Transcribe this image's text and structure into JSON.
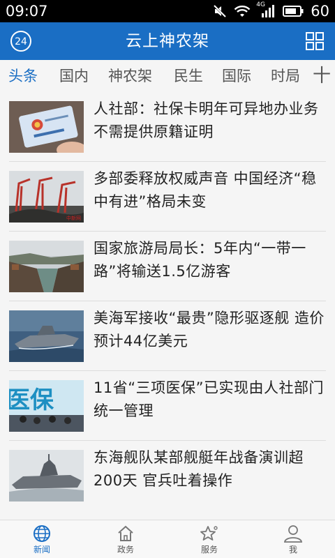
{
  "status_bar": {
    "time": "09:07",
    "network_label": "4G",
    "battery": "60",
    "icons": [
      "mute-icon",
      "wifi-icon",
      "cell-signal-icon",
      "battery-icon"
    ]
  },
  "app_bar": {
    "title": "云上神农架",
    "logo_text": "24",
    "accent_color": "#1a6ec4"
  },
  "tabs": [
    {
      "label": "头条",
      "active": true
    },
    {
      "label": "国内",
      "active": false
    },
    {
      "label": "神农架",
      "active": false
    },
    {
      "label": "民生",
      "active": false
    },
    {
      "label": "国际",
      "active": false
    },
    {
      "label": "时局",
      "active": false
    }
  ],
  "tabs_more": "十",
  "news": [
    {
      "title": "人社部：社保卡明年可异地办业务 不需提供原籍证明",
      "thumb": "social-security-card"
    },
    {
      "title": "多部委释放权威声音 中国经济“稳中有进”格局未变",
      "thumb": "port-cranes"
    },
    {
      "title": "国家旅游局局长：5年内“一带一路”将输送1.5亿游客",
      "thumb": "river-town"
    },
    {
      "title": "美海军接收“最贵”隐形驱逐舰 造价预计44亿美元",
      "thumb": "stealth-destroyer"
    },
    {
      "title": "11省“三项医保”已实现由人社部门统一管理",
      "thumb": "medical-insurance-sign"
    },
    {
      "title": "东海舰队某部舰艇年战备演训超200天 官兵吐着操作",
      "thumb": "navy-warship"
    }
  ],
  "bottom_nav": [
    {
      "label": "新闻",
      "icon": "globe-icon",
      "active": true
    },
    {
      "label": "政务",
      "icon": "government-building-icon",
      "active": false
    },
    {
      "label": "服务",
      "icon": "star-icon",
      "active": false
    },
    {
      "label": "我",
      "icon": "user-icon",
      "active": false
    }
  ]
}
